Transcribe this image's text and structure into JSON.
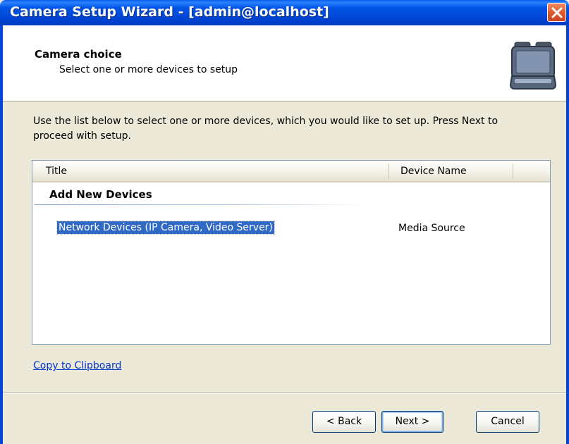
{
  "window": {
    "title": "Camera Setup Wizard - [admin@localhost]"
  },
  "header": {
    "title": "Camera choice",
    "subtitle": "Select one or more devices to setup",
    "icon": "camera-case-icon"
  },
  "instructions": "Use the list below to select one or more devices, which you would like to set up. Press Next to proceed with setup.",
  "list": {
    "columns": [
      "Title",
      "Device Name"
    ],
    "group": "Add New Devices",
    "rows": [
      {
        "title": "Network Devices (IP Camera, Video Server)",
        "device_name": "Media Source",
        "selected": true
      }
    ]
  },
  "links": {
    "copy": "Copy to Clipboard"
  },
  "buttons": {
    "back": "Back",
    "next": "Next",
    "cancel": "Cancel"
  },
  "colors": {
    "titlebar": "#0055E5",
    "selection": "#316AC5",
    "close": "#E05A2B",
    "link": "#0033CC"
  }
}
